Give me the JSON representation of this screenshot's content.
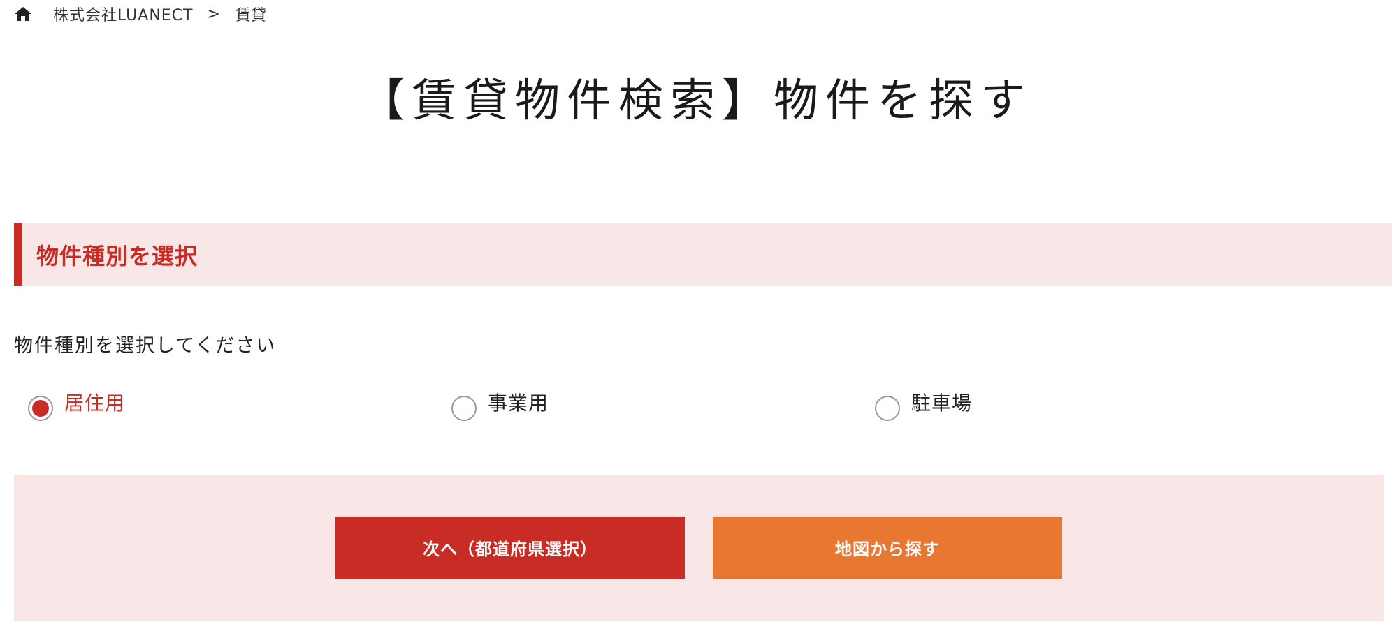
{
  "breadcrumb": {
    "home_icon": "home-icon",
    "company": "株式会社LUANECT",
    "separator": ">",
    "current": "賃貸"
  },
  "page_title": "【賃貸物件検索】物件を探す",
  "section": {
    "title": "物件種別を選択",
    "instruction": "物件種別を選択してください"
  },
  "property_types": [
    {
      "label": "居住用",
      "selected": true
    },
    {
      "label": "事業用",
      "selected": false
    },
    {
      "label": "駐車場",
      "selected": false
    }
  ],
  "actions": {
    "next_label": "次へ（都道府県選択）",
    "map_label": "地図から探す"
  },
  "colors": {
    "accent_red": "#c92c24",
    "accent_orange": "#e87731",
    "panel_pink": "#f8e7e6"
  }
}
